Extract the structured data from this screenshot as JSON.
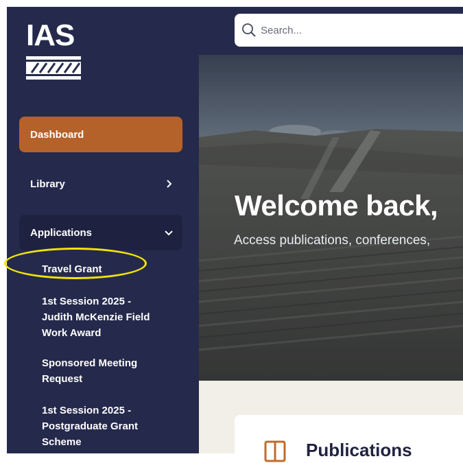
{
  "brand": {
    "logo_text": "IAS"
  },
  "search": {
    "placeholder": "Search..."
  },
  "sidebar": {
    "items": [
      {
        "label": "Dashboard"
      },
      {
        "label": "Library"
      },
      {
        "label": "Applications"
      }
    ],
    "applications_subitems": [
      {
        "lines": [
          "Travel Grant"
        ]
      },
      {
        "lines": [
          "1st Session 2025 -",
          "Judith McKenzie Field",
          "Work Award"
        ]
      },
      {
        "lines": [
          "Sponsored Meeting",
          "Request"
        ]
      },
      {
        "lines": [
          "1st Session 2025 -",
          "Postgraduate Grant",
          "Scheme"
        ]
      }
    ]
  },
  "hero": {
    "title": "Welcome back,",
    "subtitle": "Access publications, conferences,"
  },
  "cards": [
    {
      "title": "Publications"
    }
  ],
  "colors": {
    "sidebar_bg": "#252a4c",
    "active_item": "#b5622a",
    "highlight": "#f2e600"
  }
}
